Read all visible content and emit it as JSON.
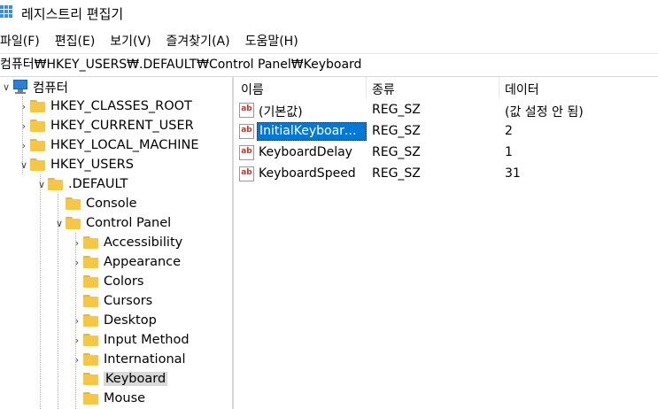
{
  "window": {
    "title": "레지스트리 편집기"
  },
  "menu": [
    "파일(F)",
    "편집(E)",
    "보기(V)",
    "즐겨찾기(A)",
    "도움말(H)"
  ],
  "address": "컴퓨터₩HKEY_USERS₩.DEFAULT₩Control Panel₩Keyboard",
  "tree": {
    "root": "컴퓨터",
    "hives": [
      "HKEY_CLASSES_ROOT",
      "HKEY_CURRENT_USER",
      "HKEY_LOCAL_MACHINE",
      "HKEY_USERS"
    ],
    "default_key": ".DEFAULT",
    "default_children": [
      "Console",
      "Control Panel"
    ],
    "control_panel_children": [
      "Accessibility",
      "Appearance",
      "Colors",
      "Cursors",
      "Desktop",
      "Input Method",
      "International",
      "Keyboard",
      "Mouse"
    ],
    "selected": "Keyboard"
  },
  "list": {
    "headers": [
      "이름",
      "종류",
      "데이터"
    ],
    "rows": [
      {
        "name": "(기본값)",
        "type": "REG_SZ",
        "data": "(값 설정 안 됨)"
      },
      {
        "name": "InitialKeyboardI...",
        "type": "REG_SZ",
        "data": "2"
      },
      {
        "name": "KeyboardDelay",
        "type": "REG_SZ",
        "data": "1"
      },
      {
        "name": "KeyboardSpeed",
        "type": "REG_SZ",
        "data": "31"
      }
    ],
    "selected_row": 1,
    "value_icon": "ab-string-icon"
  },
  "colors": {
    "folder": "#f6c744",
    "selection": "#0078d7",
    "tree_selection": "#d9d9d9"
  }
}
